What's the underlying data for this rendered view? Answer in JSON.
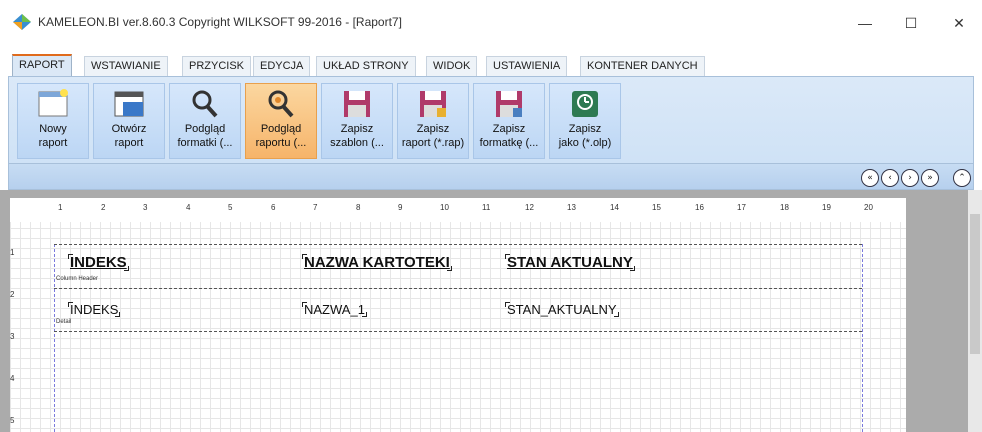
{
  "window": {
    "title": "KAMELEON.BI ver.8.60.3 Copyright WILKSOFT 99-2016 - [Raport7]",
    "minimize": "—",
    "maximize": "☐",
    "close": "✕"
  },
  "tabs": [
    {
      "label": "RAPORT"
    },
    {
      "label": "WSTAWIANIE"
    },
    {
      "label": "PRZYCISK"
    },
    {
      "label": "EDYCJA"
    },
    {
      "label": "UKŁAD STRONY"
    },
    {
      "label": "WIDOK"
    },
    {
      "label": "USTAWIENIA"
    },
    {
      "label": "KONTENER DANYCH"
    }
  ],
  "ribbon": {
    "buttons": [
      {
        "line1": "Nowy",
        "line2": "raport",
        "icon": "new-report-icon"
      },
      {
        "line1": "Otwórz",
        "line2": "raport",
        "icon": "open-report-icon"
      },
      {
        "line1": "Podgląd",
        "line2": "formatki (...",
        "icon": "preview-form-icon"
      },
      {
        "line1": "Podgląd",
        "line2": "raportu (...",
        "icon": "preview-report-icon"
      },
      {
        "line1": "Zapisz",
        "line2": "szablon (...",
        "icon": "save-template-icon"
      },
      {
        "line1": "Zapisz",
        "line2": "raport (*.rap)",
        "icon": "save-report-icon"
      },
      {
        "line1": "Zapisz",
        "line2": "formatkę (...",
        "icon": "save-form-icon"
      },
      {
        "line1": "Zapisz",
        "line2": "jako (*.olp)",
        "icon": "save-as-olp-icon"
      }
    ]
  },
  "nav": {
    "first": "«",
    "prev": "‹",
    "next": "›",
    "last": "»",
    "collapse": "⌃"
  },
  "ruler": {
    "top": [
      "1",
      "2",
      "3",
      "4",
      "5",
      "6",
      "7",
      "8",
      "9",
      "10",
      "11",
      "12",
      "13",
      "14",
      "15",
      "16",
      "17",
      "18",
      "19",
      "20"
    ],
    "left": [
      "1",
      "2",
      "3",
      "4",
      "5"
    ]
  },
  "report": {
    "bands": {
      "column_header": "Column Header",
      "detail": "Detail"
    },
    "header_fields": [
      "INDEKS",
      "NAZWA KARTOTEKI",
      "STAN AKTUALNY"
    ],
    "detail_fields": [
      "INDEKS",
      "NAZWA_1",
      "STAN_AKTUALNY"
    ]
  },
  "colors": {
    "accent": "#e06b1c",
    "ribbon": "#cfe2f6",
    "active_button": "#f6b46a"
  }
}
